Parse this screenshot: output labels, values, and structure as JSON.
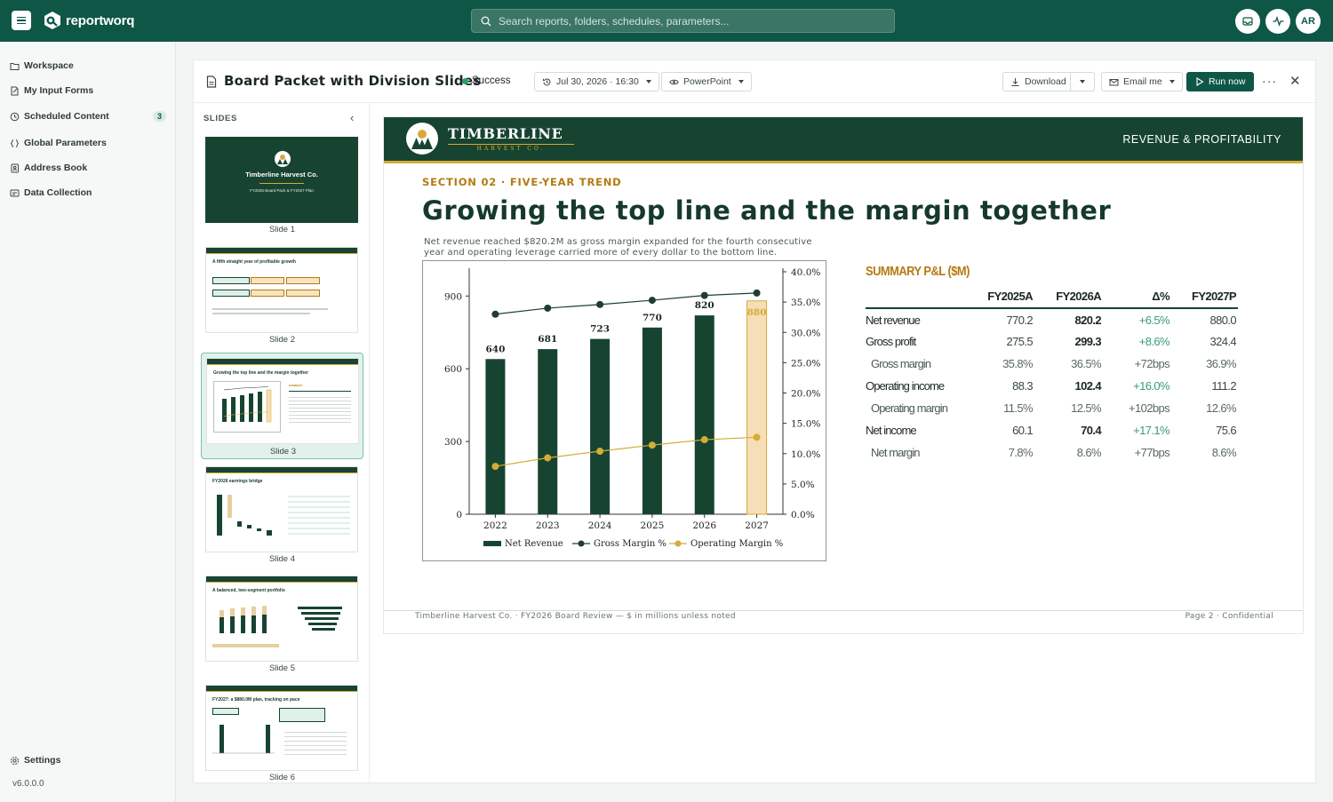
{
  "app": {
    "brand": "reportworq",
    "search_placeholder": "Search reports, folders, schedules, parameters...",
    "avatar": "AR"
  },
  "sidebar": {
    "items": [
      {
        "label": "Workspace",
        "icon": "folder-icon"
      },
      {
        "label": "My Input Forms",
        "icon": "form-icon"
      },
      {
        "label": "Scheduled Content",
        "icon": "clock-icon",
        "badge": "3"
      },
      {
        "label": "Global Parameters",
        "icon": "braces-icon"
      },
      {
        "label": "Address Book",
        "icon": "contacts-icon"
      },
      {
        "label": "Data Collection",
        "icon": "collection-icon"
      }
    ],
    "settings": "Settings",
    "version": "v6.0.0.0"
  },
  "header": {
    "title": "Board Packet with Division Slides",
    "status": "Success",
    "run_time": "Jul 30, 2026 · 16:30",
    "format": "PowerPoint",
    "download": "Download",
    "email": "Email me",
    "run": "Run now"
  },
  "rail": {
    "heading": "SLIDES",
    "slides": [
      "Slide 1",
      "Slide 2",
      "Slide 3",
      "Slide 4",
      "Slide 5",
      "Slide 6"
    ],
    "thumb_texts": {
      "s1_title": "Timberline Harvest Co.",
      "s1_sub": "FY2026 Board Pack & FY2027 Plan",
      "s2_title": "A fifth straight year of profitable growth",
      "s3_title": "Growing the top line and the margin together",
      "s4_title": "FY2026 earnings bridge",
      "s5_title": "A balanced, two-segment portfolio",
      "s6_title": "FY2027: a $880.0M plan, tracking on pace"
    }
  },
  "slide": {
    "brand": "TIMBERLINE",
    "brand_sub": "HARVEST CO.",
    "band_right": "REVENUE & PROFITABILITY",
    "kicker": "SECTION 02 · FIVE-YEAR TREND",
    "headline": "Growing the top line and the margin together",
    "lede": "Net revenue reached $820.2M as gross margin expanded for the fourth consecutive year and operating leverage carried more of every dollar to the bottom line.",
    "footer_left": "Timberline Harvest Co.  ·  FY2026 Board Review   —   $ in millions unless noted",
    "footer_right": "Page 2 · Confidential",
    "pl": {
      "title": "SUMMARY P&L ($M)",
      "headers": [
        "",
        "FY2025A",
        "FY2026A",
        "Δ%",
        "FY2027P"
      ],
      "rows": [
        {
          "label": "Net revenue",
          "v": [
            "770.2",
            "820.2",
            "+6.5%",
            "880.0"
          ],
          "sub": false
        },
        {
          "label": "Gross profit",
          "v": [
            "275.5",
            "299.3",
            "+8.6%",
            "324.4"
          ],
          "sub": false
        },
        {
          "label": "Gross margin",
          "v": [
            "35.8%",
            "36.5%",
            "+72bps",
            "36.9%"
          ],
          "sub": true
        },
        {
          "label": "Operating income",
          "v": [
            "88.3",
            "102.4",
            "+16.0%",
            "111.2"
          ],
          "sub": false
        },
        {
          "label": "Operating margin",
          "v": [
            "11.5%",
            "12.5%",
            "+102bps",
            "12.6%"
          ],
          "sub": true
        },
        {
          "label": "Net income",
          "v": [
            "60.1",
            "70.4",
            "+17.1%",
            "75.6"
          ],
          "sub": false
        },
        {
          "label": "Net margin",
          "v": [
            "7.8%",
            "8.6%",
            "+77bps",
            "8.6%"
          ],
          "sub": true
        }
      ]
    }
  },
  "chart_data": {
    "type": "bar",
    "categories": [
      "2022",
      "2023",
      "2024",
      "2025",
      "2026",
      "2027"
    ],
    "series": [
      {
        "name": "Net Revenue",
        "type": "bar",
        "axis": "left",
        "values": [
          640,
          681,
          723,
          770,
          820,
          880
        ],
        "data_labels": [
          "640",
          "681",
          "723",
          "770",
          "820",
          "880"
        ],
        "color": "#174430",
        "projected_color": "#f6dfb6"
      },
      {
        "name": "Gross Margin %",
        "type": "line",
        "axis": "right",
        "values": [
          33.0,
          34.0,
          34.6,
          35.3,
          36.1,
          36.5
        ],
        "color": "#1f3d33"
      },
      {
        "name": "Operating Margin %",
        "type": "line",
        "axis": "right",
        "values": [
          7.9,
          9.3,
          10.4,
          11.4,
          12.3,
          12.7
        ],
        "color": "#d4ac38"
      }
    ],
    "ylim": [
      0,
      1000
    ],
    "y_ticks": [
      "0",
      "300",
      "600",
      "900"
    ],
    "y2lim": [
      0,
      40
    ],
    "y2_ticks": [
      "0.0%",
      "5.0%",
      "10.0%",
      "15.0%",
      "20.0%",
      "25.0%",
      "30.0%",
      "35.0%",
      "40.0%"
    ],
    "legend": "bottom",
    "grid": false
  },
  "colors": {
    "brand_green": "#0e5747",
    "slide_green": "#174430",
    "gold": "#d7a93a",
    "accent_text": "#b47a12"
  }
}
